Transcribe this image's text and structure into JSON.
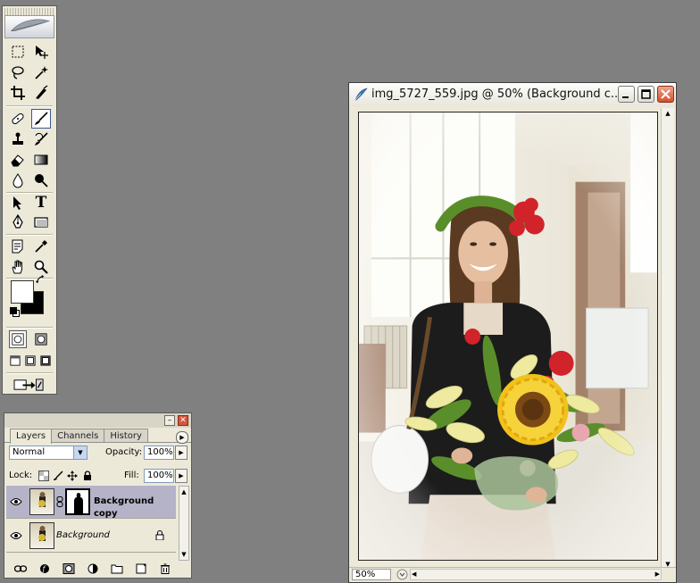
{
  "tools_palette": {
    "tools": [
      {
        "name": "rectangular-marquee-tool",
        "icon": "marquee-icon"
      },
      {
        "name": "move-tool",
        "icon": "move-icon"
      },
      {
        "name": "lasso-tool",
        "icon": "lasso-icon"
      },
      {
        "name": "magic-wand-tool",
        "icon": "magic-wand-icon"
      },
      {
        "name": "crop-tool",
        "icon": "crop-icon"
      },
      {
        "name": "slice-tool",
        "icon": "slice-icon"
      },
      {
        "name": "healing-brush-tool",
        "icon": "bandage-icon"
      },
      {
        "name": "brush-tool",
        "icon": "brush-icon",
        "active": true
      },
      {
        "name": "clone-stamp-tool",
        "icon": "stamp-icon"
      },
      {
        "name": "history-brush-tool",
        "icon": "history-brush-icon"
      },
      {
        "name": "eraser-tool",
        "icon": "eraser-icon"
      },
      {
        "name": "gradient-tool",
        "icon": "gradient-icon"
      },
      {
        "name": "blur-tool",
        "icon": "drop-icon"
      },
      {
        "name": "dodge-tool",
        "icon": "dodge-icon"
      },
      {
        "name": "path-selection-tool",
        "icon": "arrow-icon"
      },
      {
        "name": "type-tool",
        "icon": "type-icon",
        "glyph": "T"
      },
      {
        "name": "pen-tool",
        "icon": "pen-icon"
      },
      {
        "name": "shape-tool",
        "icon": "rectangle-icon"
      },
      {
        "name": "notes-tool",
        "icon": "notes-icon"
      },
      {
        "name": "eyedropper-tool",
        "icon": "eyedropper-icon"
      },
      {
        "name": "hand-tool",
        "icon": "hand-icon"
      },
      {
        "name": "zoom-tool",
        "icon": "zoom-icon"
      }
    ],
    "foreground_color": "#ffffff",
    "background_color": "#000000"
  },
  "layers_palette": {
    "tabs": [
      "Layers",
      "Channels",
      "History"
    ],
    "active_tab": "Layers",
    "blend_mode": "Normal",
    "opacity_label": "Opacity:",
    "opacity_value": "100%",
    "lock_label": "Lock:",
    "fill_label": "Fill:",
    "fill_value": "100%",
    "layers": [
      {
        "name": "Background copy",
        "selected": true,
        "visible": true,
        "has_mask": true
      },
      {
        "name": "Background",
        "selected": false,
        "visible": true,
        "locked": true
      }
    ]
  },
  "document": {
    "title": "img_5727_559.jpg @ 50% (Background c...",
    "zoom": "50%",
    "colors": {
      "wall": "#f2efe6",
      "window": "#fbfbf6",
      "jacket": "#1c1c1c",
      "skirt": "#e6dbcf",
      "sunflower": "#f1c21b",
      "leaves": "#5a8e2a",
      "red_flower": "#d1232a"
    }
  }
}
